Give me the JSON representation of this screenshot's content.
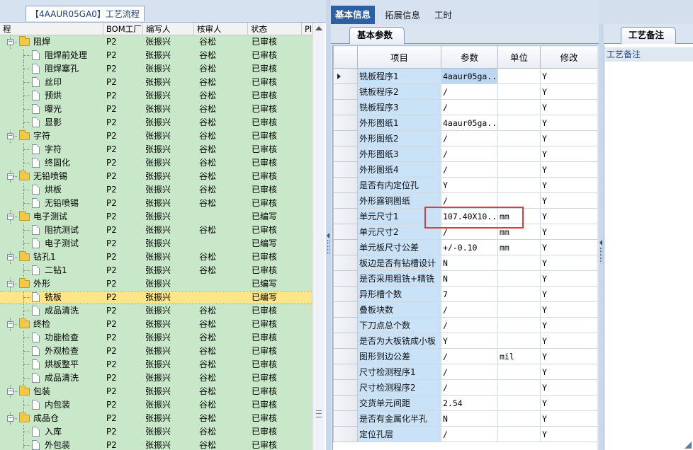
{
  "left": {
    "tab_title": "【4AAUR05GA0】工艺流程",
    "columns": [
      "程",
      "BOM工厂",
      "编写人",
      "核审人",
      "状态",
      "Pl"
    ],
    "rows": [
      {
        "level": 0,
        "label": "阻焊",
        "bom": "P2",
        "writer": "张振兴",
        "reviewer": "谷松",
        "status": "已审核",
        "open": "−"
      },
      {
        "level": 1,
        "label": "阻焊前处理",
        "bom": "P2",
        "writer": "张振兴",
        "reviewer": "谷松",
        "status": "已审核"
      },
      {
        "level": 1,
        "label": "阻焊塞孔",
        "bom": "P2",
        "writer": "张振兴",
        "reviewer": "谷松",
        "status": "已审核"
      },
      {
        "level": 1,
        "label": "丝印",
        "bom": "P2",
        "writer": "张振兴",
        "reviewer": "谷松",
        "status": "已审核"
      },
      {
        "level": 1,
        "label": "预烘",
        "bom": "P2",
        "writer": "张振兴",
        "reviewer": "谷松",
        "status": "已审核"
      },
      {
        "level": 1,
        "label": "曝光",
        "bom": "P2",
        "writer": "张振兴",
        "reviewer": "谷松",
        "status": "已审核"
      },
      {
        "level": 1,
        "label": "显影",
        "bom": "P2",
        "writer": "张振兴",
        "reviewer": "谷松",
        "status": "已审核"
      },
      {
        "level": 0,
        "label": "字符",
        "bom": "P2",
        "writer": "张振兴",
        "reviewer": "谷松",
        "status": "已审核",
        "open": "−"
      },
      {
        "level": 1,
        "label": "字符",
        "bom": "P2",
        "writer": "张振兴",
        "reviewer": "谷松",
        "status": "已审核"
      },
      {
        "level": 1,
        "label": "终固化",
        "bom": "P2",
        "writer": "张振兴",
        "reviewer": "谷松",
        "status": "已审核"
      },
      {
        "level": 0,
        "label": "无铅喷锡",
        "bom": "P2",
        "writer": "张振兴",
        "reviewer": "谷松",
        "status": "已审核",
        "open": "−"
      },
      {
        "level": 1,
        "label": "烘板",
        "bom": "P2",
        "writer": "张振兴",
        "reviewer": "谷松",
        "status": "已审核"
      },
      {
        "level": 1,
        "label": "无铅喷锡",
        "bom": "P2",
        "writer": "张振兴",
        "reviewer": "谷松",
        "status": "已审核"
      },
      {
        "level": 0,
        "label": "电子测试",
        "bom": "P2",
        "writer": "张振兴",
        "reviewer": "",
        "status": "已编写",
        "open": "−"
      },
      {
        "level": 1,
        "label": "阻抗测试",
        "bom": "P2",
        "writer": "张振兴",
        "reviewer": "谷松",
        "status": "已审核"
      },
      {
        "level": 1,
        "label": "电子测试",
        "bom": "P2",
        "writer": "张振兴",
        "reviewer": "",
        "status": "已编写"
      },
      {
        "level": 0,
        "label": "钻孔1",
        "bom": "P2",
        "writer": "张振兴",
        "reviewer": "谷松",
        "status": "已审核",
        "open": "−"
      },
      {
        "level": 1,
        "label": "二钻1",
        "bom": "P2",
        "writer": "张振兴",
        "reviewer": "谷松",
        "status": "已审核"
      },
      {
        "level": 0,
        "label": "外形",
        "bom": "P2",
        "writer": "张振兴",
        "reviewer": "",
        "status": "已编写",
        "open": "−"
      },
      {
        "level": 1,
        "label": "铣板",
        "bom": "P2",
        "writer": "张振兴",
        "reviewer": "",
        "status": "已编写",
        "selected": true
      },
      {
        "level": 1,
        "label": "成品清洗",
        "bom": "P2",
        "writer": "张振兴",
        "reviewer": "谷松",
        "status": "已审核"
      },
      {
        "level": 0,
        "label": "终检",
        "bom": "P2",
        "writer": "张振兴",
        "reviewer": "谷松",
        "status": "已审核",
        "open": "−"
      },
      {
        "level": 1,
        "label": "功能检查",
        "bom": "P2",
        "writer": "张振兴",
        "reviewer": "谷松",
        "status": "已审核"
      },
      {
        "level": 1,
        "label": "外观检查",
        "bom": "P2",
        "writer": "张振兴",
        "reviewer": "谷松",
        "status": "已审核"
      },
      {
        "level": 1,
        "label": "烘板整平",
        "bom": "P2",
        "writer": "张振兴",
        "reviewer": "谷松",
        "status": "已审核"
      },
      {
        "level": 1,
        "label": "成品清洗",
        "bom": "P2",
        "writer": "张振兴",
        "reviewer": "谷松",
        "status": "已审核"
      },
      {
        "level": 0,
        "label": "包装",
        "bom": "P2",
        "writer": "张振兴",
        "reviewer": "谷松",
        "status": "已审核",
        "open": "−"
      },
      {
        "level": 1,
        "label": "内包装",
        "bom": "P2",
        "writer": "张振兴",
        "reviewer": "谷松",
        "status": "已审核"
      },
      {
        "level": 0,
        "label": "成品仓",
        "bom": "P2",
        "writer": "张振兴",
        "reviewer": "谷松",
        "status": "已审核",
        "open": "−"
      },
      {
        "level": 1,
        "label": "入库",
        "bom": "P2",
        "writer": "张振兴",
        "reviewer": "谷松",
        "status": "已审核"
      },
      {
        "level": 1,
        "label": "外包装",
        "bom": "P2",
        "writer": "张振兴",
        "reviewer": "谷松",
        "status": "已审核"
      }
    ]
  },
  "tabs": {
    "top": [
      "基本信息",
      "拓展信息",
      "工时"
    ],
    "sub": "基本参数",
    "right": "工艺备注"
  },
  "grid": {
    "columns": [
      "项目",
      "参数",
      "单位",
      "修改"
    ],
    "rows": [
      {
        "item": "铣板程序1",
        "param": "4aaur05ga...",
        "unit": "",
        "mod": "Y",
        "current": true
      },
      {
        "item": "铣板程序2",
        "param": "/",
        "unit": "",
        "mod": "Y"
      },
      {
        "item": "铣板程序3",
        "param": "/",
        "unit": "",
        "mod": "Y"
      },
      {
        "item": "外形图纸1",
        "param": "4aaur05ga...",
        "unit": "",
        "mod": "Y"
      },
      {
        "item": "外形图纸2",
        "param": "/",
        "unit": "",
        "mod": "Y"
      },
      {
        "item": "外形图纸3",
        "param": "/",
        "unit": "",
        "mod": "Y"
      },
      {
        "item": "外形图纸4",
        "param": "/",
        "unit": "",
        "mod": "Y"
      },
      {
        "item": "是否有内定位孔",
        "param": "Y",
        "unit": "",
        "mod": "Y"
      },
      {
        "item": "外形露铜图纸",
        "param": "/",
        "unit": "",
        "mod": "Y"
      },
      {
        "item": "单元尺寸1",
        "param": "107.40X10...",
        "unit": "mm",
        "mod": "Y"
      },
      {
        "item": "单元尺寸2",
        "param": "/",
        "unit": "mm",
        "mod": "Y"
      },
      {
        "item": "单元板尺寸公差",
        "param": "+/-0.10",
        "unit": "mm",
        "mod": "Y"
      },
      {
        "item": "板边是否有钻槽设计",
        "param": "N",
        "unit": "",
        "mod": "Y"
      },
      {
        "item": "是否采用粗铣+精铣",
        "param": "N",
        "unit": "",
        "mod": "Y"
      },
      {
        "item": "异形槽个数",
        "param": "7",
        "unit": "",
        "mod": "Y"
      },
      {
        "item": "叠板块数",
        "param": "/",
        "unit": "",
        "mod": "Y"
      },
      {
        "item": "下刀点总个数",
        "param": "/",
        "unit": "",
        "mod": "Y"
      },
      {
        "item": "是否为大板铣成小板",
        "param": "Y",
        "unit": "",
        "mod": "Y"
      },
      {
        "item": "图形到边公差",
        "param": "/",
        "unit": "mil",
        "mod": "Y"
      },
      {
        "item": "尺寸检测程序1",
        "param": "/",
        "unit": "",
        "mod": "Y"
      },
      {
        "item": "尺寸检测程序2",
        "param": "/",
        "unit": "",
        "mod": "Y"
      },
      {
        "item": "交货单元间距",
        "param": "2.54",
        "unit": "",
        "mod": "Y"
      },
      {
        "item": "是否有金属化半孔",
        "param": "N",
        "unit": "",
        "mod": "Y"
      },
      {
        "item": "定位孔层",
        "param": "/",
        "unit": "",
        "mod": "Y"
      }
    ]
  },
  "remark": {
    "label": "工艺备注"
  },
  "colors": {
    "tree_bg": "#c9e8c9",
    "selected_row": "#ffe58a",
    "tab_active": "#2e5fa3",
    "item_cell": "#c9e2f8",
    "highlight": "#e23a3a"
  }
}
